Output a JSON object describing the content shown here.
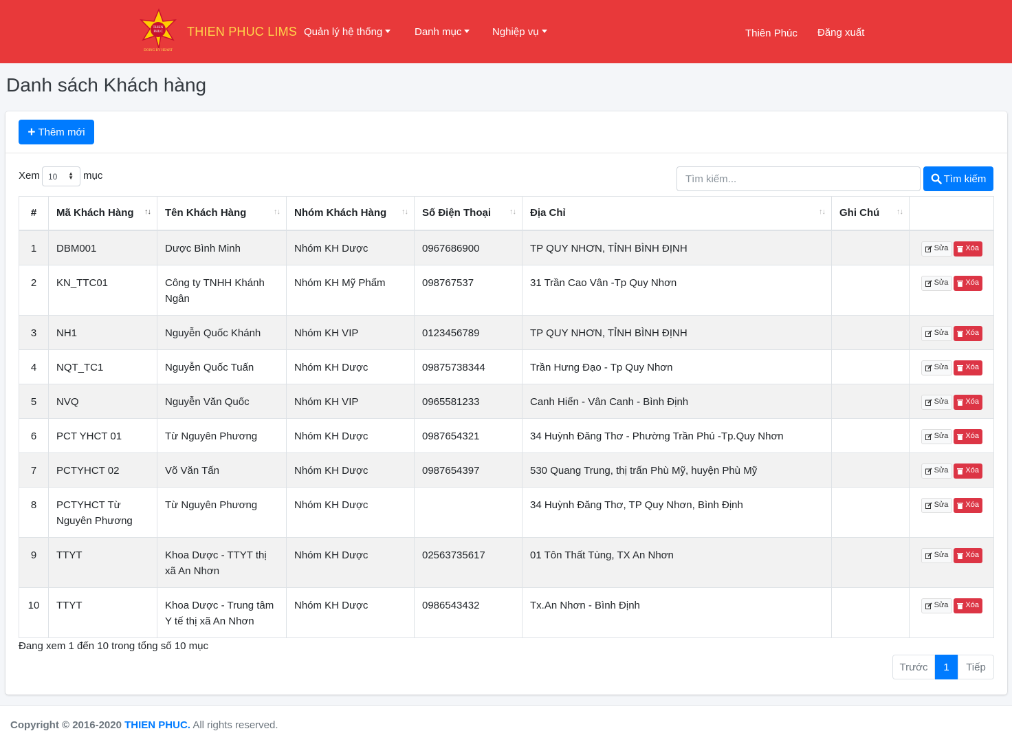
{
  "navbar": {
    "brand": "THIEN PHUC LIMS",
    "logo_text_top": "THIEN PHUC",
    "logo_text_bottom": "DOING BY HEART",
    "menu": [
      {
        "label": "Quản lý hệ thống"
      },
      {
        "label": "Danh mục"
      },
      {
        "label": "Nghiệp vụ"
      }
    ],
    "user": "Thiên Phúc",
    "logout": "Đăng xuất",
    "bg_color": "#e8393a",
    "brand_color": "#ffd54a"
  },
  "page": {
    "title": "Danh sách Khách hàng",
    "add_button": "Thêm mới",
    "length_prefix": "Xem",
    "length_value": "10",
    "length_suffix": "mục",
    "search_placeholder": "Tìm kiếm...",
    "search_button": "Tìm kiếm"
  },
  "table": {
    "columns": [
      "#",
      "Mã Khách Hàng",
      "Tên Khách Hàng",
      "Nhóm Khách Hàng",
      "Số Điện Thoại",
      "Địa Chỉ",
      "Ghi Chú",
      ""
    ],
    "edit_label": "Sửa",
    "delete_label": "Xóa",
    "rows": [
      {
        "no": "1",
        "code": "DBM001",
        "name": "Dược Bình Minh",
        "group": "Nhóm KH Dược",
        "phone": "0967686900",
        "address": "TP QUY NHƠN, TỈNH BÌNH ĐỊNH",
        "note": ""
      },
      {
        "no": "2",
        "code": "KN_TTC01",
        "name": "Công ty TNHH Khánh Ngân",
        "group": "Nhóm KH Mỹ Phẩm",
        "phone": "098767537",
        "address": "31 Trần Cao Vân -Tp Quy Nhơn",
        "note": ""
      },
      {
        "no": "3",
        "code": "NH1",
        "name": "Nguyễn Quốc Khánh",
        "group": "Nhóm KH VIP",
        "phone": "0123456789",
        "address": "TP QUY NHƠN, TỈNH BÌNH ĐỊNH",
        "note": ""
      },
      {
        "no": "4",
        "code": "NQT_TC1",
        "name": "Nguyễn Quốc Tuấn",
        "group": "Nhóm KH Dược",
        "phone": "09875738344",
        "address": "Trần Hưng Đạo - Tp Quy Nhơn",
        "note": ""
      },
      {
        "no": "5",
        "code": "NVQ",
        "name": "Nguyễn Văn Quốc",
        "group": "Nhóm KH VIP",
        "phone": "0965581233",
        "address": "Canh Hiển - Vân Canh - Bình Định",
        "note": ""
      },
      {
        "no": "6",
        "code": "PCT YHCT 01",
        "name": "Từ Nguyên Phương",
        "group": "Nhóm KH Dược",
        "phone": "0987654321",
        "address": "34 Huỳnh Đăng Thơ - Phường Trần Phú -Tp.Quy Nhơn",
        "note": ""
      },
      {
        "no": "7",
        "code": "PCTYHCT 02",
        "name": "Võ Văn Tấn",
        "group": "Nhóm KH Dược",
        "phone": "0987654397",
        "address": "530 Quang Trung, thị trấn Phù Mỹ, huyện Phù Mỹ",
        "note": ""
      },
      {
        "no": "8",
        "code": "PCTYHCT Từ Nguyên Phương",
        "name": "Từ Nguyên Phương",
        "group": "Nhóm KH Dược",
        "phone": "",
        "address": "34 Huỳnh Đăng Thơ, TP Quy Nhơn, Bình Định",
        "note": ""
      },
      {
        "no": "9",
        "code": "TTYT",
        "name": "Khoa Dược - TTYT thị xã An Nhơn",
        "group": "Nhóm KH Dược",
        "phone": "02563735617",
        "address": "01 Tôn Thất Tùng, TX An Nhơn",
        "note": ""
      },
      {
        "no": "10",
        "code": "TTYT",
        "name": "Khoa Dược - Trung tâm Y tế thị xã An Nhơn",
        "group": "Nhóm KH Dược",
        "phone": "0986543432",
        "address": "Tx.An Nhơn - Bình Định",
        "note": ""
      }
    ]
  },
  "footer_info": "Đang xem 1 đến 10 trong tổng số 10 mục",
  "pagination": {
    "prev": "Trước",
    "current": "1",
    "next": "Tiếp"
  },
  "footer": {
    "copyright": "Copyright © 2016-2020",
    "company": "THIEN PHUC.",
    "rights": "All rights reserved."
  },
  "colors": {
    "primary": "#007bff",
    "danger": "#dc3545"
  }
}
